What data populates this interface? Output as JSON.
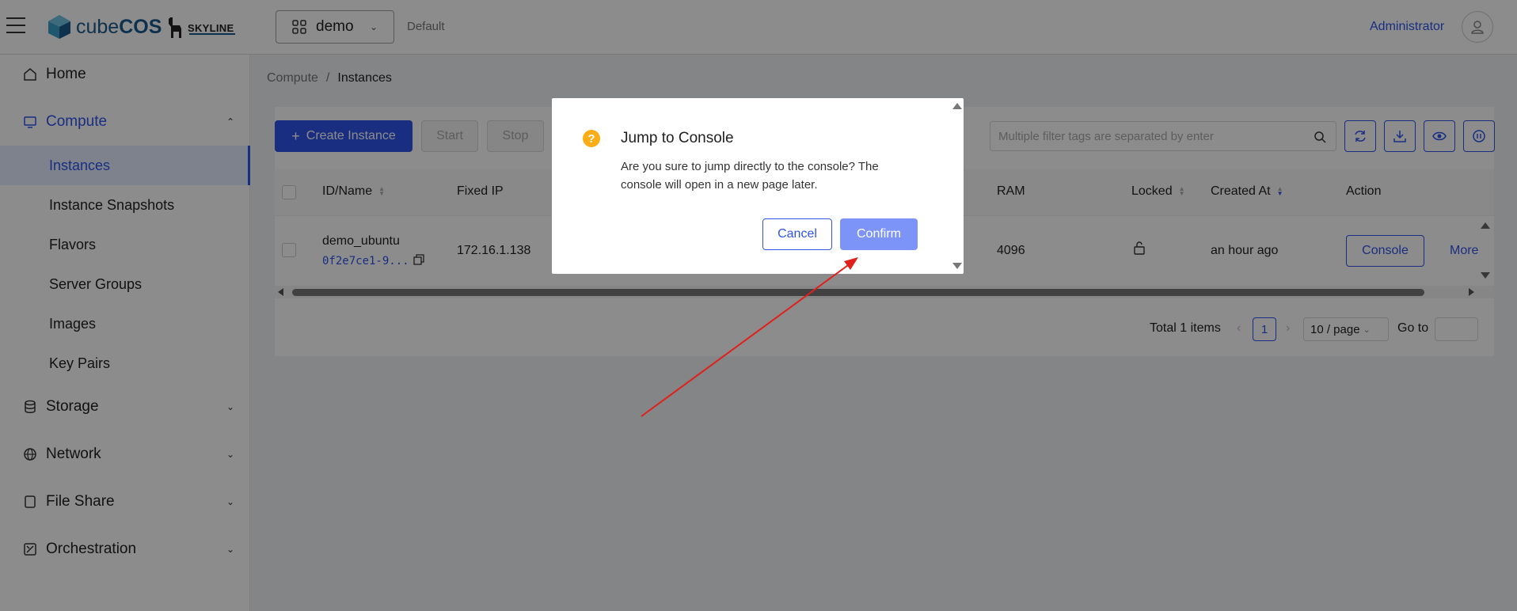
{
  "header": {
    "brand": "cube",
    "brand_bold": "COS",
    "skyline": "SKYLINE",
    "project": "demo",
    "domain": "Default",
    "user": "Administrator"
  },
  "sidebar": {
    "items": [
      {
        "label": "Home",
        "icon": "home-icon"
      },
      {
        "label": "Compute",
        "icon": "monitor-icon"
      },
      {
        "label": "Storage",
        "icon": "database-icon"
      },
      {
        "label": "Network",
        "icon": "globe-icon"
      },
      {
        "label": "File Share",
        "icon": "file-share-icon"
      },
      {
        "label": "Orchestration",
        "icon": "orchestration-icon"
      }
    ],
    "compute_sub": [
      "Instances",
      "Instance Snapshots",
      "Flavors",
      "Server Groups",
      "Images",
      "Key Pairs"
    ]
  },
  "breadcrumb": {
    "parent": "Compute",
    "sep": "/",
    "current": "Instances"
  },
  "toolbar": {
    "create": "Create Instance",
    "start": "Start",
    "stop": "Stop",
    "search_placeholder": "Multiple filter tags are separated by enter"
  },
  "table": {
    "headers": {
      "id_name": "ID/Name",
      "fixed_ip": "Fixed IP",
      "ram": "RAM",
      "locked": "Locked",
      "created_at": "Created At",
      "action": "Action"
    },
    "row": {
      "name": "demo_ubuntu",
      "id": "0f2e7ce1-9...",
      "fixed_ip": "172.16.1.138",
      "ram": "4096",
      "created_at": "an hour ago",
      "console": "Console",
      "more": "More"
    }
  },
  "pagination": {
    "total": "Total 1 items",
    "page": "1",
    "page_size": "10 / page",
    "goto": "Go to"
  },
  "modal": {
    "title": "Jump to Console",
    "body": "Are you sure to jump directly to the console? The console will open in a new page later.",
    "cancel": "Cancel",
    "confirm": "Confirm"
  },
  "colors": {
    "accent": "#2f54eb",
    "confirm_bg": "#7c93f8",
    "warning": "#faad14",
    "annotation_arrow": "#e0201b"
  }
}
